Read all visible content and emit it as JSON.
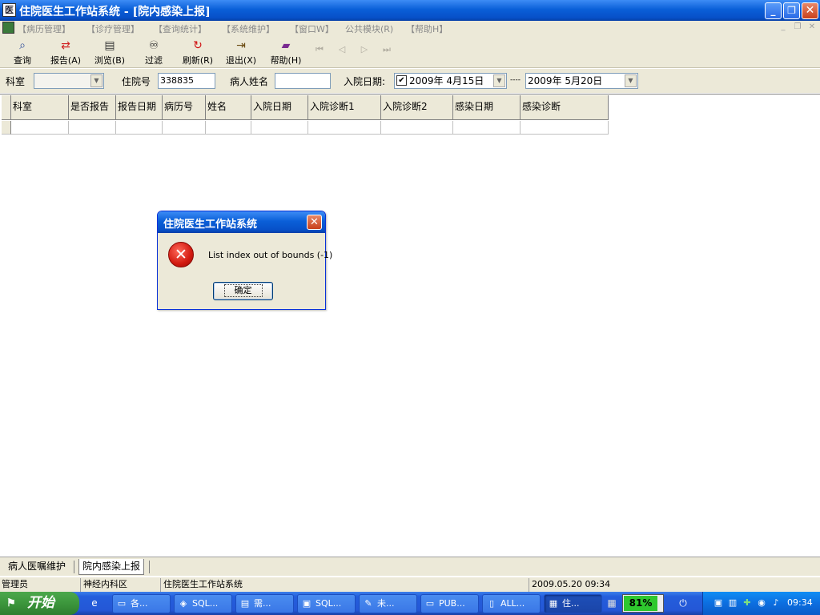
{
  "window": {
    "title": "住院医生工作站系统 - [院内感染上报]",
    "buttons": {
      "minimize": "_",
      "restore": "❐",
      "close": "✕"
    }
  },
  "menu": {
    "items": [
      "【病历管理】",
      "【诊疗管理】",
      "【查询统计】",
      "【系统维护】",
      "【窗口W】",
      "公共模块(R)",
      "【帮助H】"
    ]
  },
  "toolbar": {
    "tools": [
      {
        "label": "查询",
        "icon": "magnifier-icon"
      },
      {
        "label": "报告(A)",
        "icon": "report-icon"
      },
      {
        "label": "浏览(B)",
        "icon": "browse-icon"
      },
      {
        "label": "过滤",
        "icon": "binoculars-icon"
      },
      {
        "label": "刷新(R)",
        "icon": "refresh-icon"
      },
      {
        "label": "退出(X)",
        "icon": "exit-door-icon"
      },
      {
        "label": "帮助(H)",
        "icon": "help-book-icon"
      }
    ]
  },
  "filters": {
    "dept_label": "科室",
    "dept_value": "",
    "inpatient_no_label": "住院号",
    "inpatient_no_value": "338835",
    "patient_name_label": "病人姓名",
    "patient_name_value": "",
    "admit_date_label": "入院日期:",
    "admit_date_checked": true,
    "date_from": "2009年 4月15日",
    "date_sep": "----",
    "date_to": "2009年 5月20日"
  },
  "grid": {
    "columns": [
      "科室",
      "是否报告",
      "报告日期",
      "病历号",
      "姓名",
      "入院日期",
      "入院诊断1",
      "入院诊断2",
      "感染日期",
      "感染诊断"
    ]
  },
  "dialog": {
    "title": "住院医生工作站系统",
    "message": "List index out of bounds (-1)",
    "ok_label": "确定",
    "close_glyph": "✕",
    "icon": "error-icon"
  },
  "tabs": [
    "病人医嘱维护",
    "院内感染上报"
  ],
  "status": {
    "user": "管理员",
    "department": "神经内科区",
    "system": "住院医生工作站系统",
    "datetime": "2009.05.20 09:34"
  },
  "taskbar": {
    "start_label": "开始",
    "tasks": [
      "各...",
      "SQL...",
      "需...",
      "SQL...",
      "未...",
      "PUB...",
      "ALL...",
      "住..."
    ],
    "battery": "81%",
    "clock": "09:34"
  },
  "colors": {
    "titlebar_blue": "#0a5fd8",
    "chrome_gray": "#ece9d8",
    "close_red": "#c8401c",
    "battery_green": "#2ec82e",
    "start_green": "#3c963c"
  }
}
